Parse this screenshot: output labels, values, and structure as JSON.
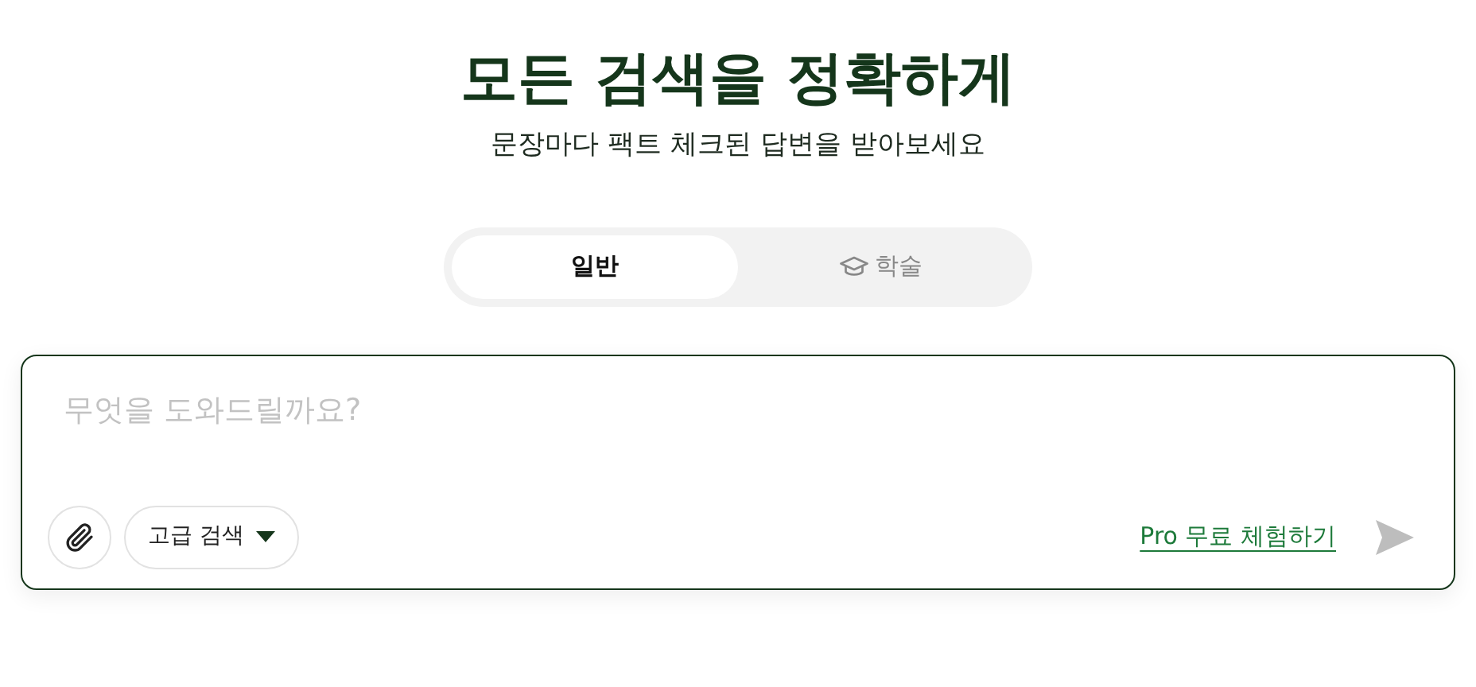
{
  "heading": "모든 검색을 정확하게",
  "subheading": "문장마다 팩트 체크된 답변을 받아보세요",
  "tabs": [
    {
      "label": "일반",
      "selected": true,
      "kind": "plain"
    },
    {
      "label": "학술",
      "selected": false,
      "kind": "academic"
    }
  ],
  "search": {
    "placeholder": "무엇을 도와드릴까요?",
    "advanced_label": "고급 검색",
    "pro_link": "Pro 무료 체험하기"
  }
}
